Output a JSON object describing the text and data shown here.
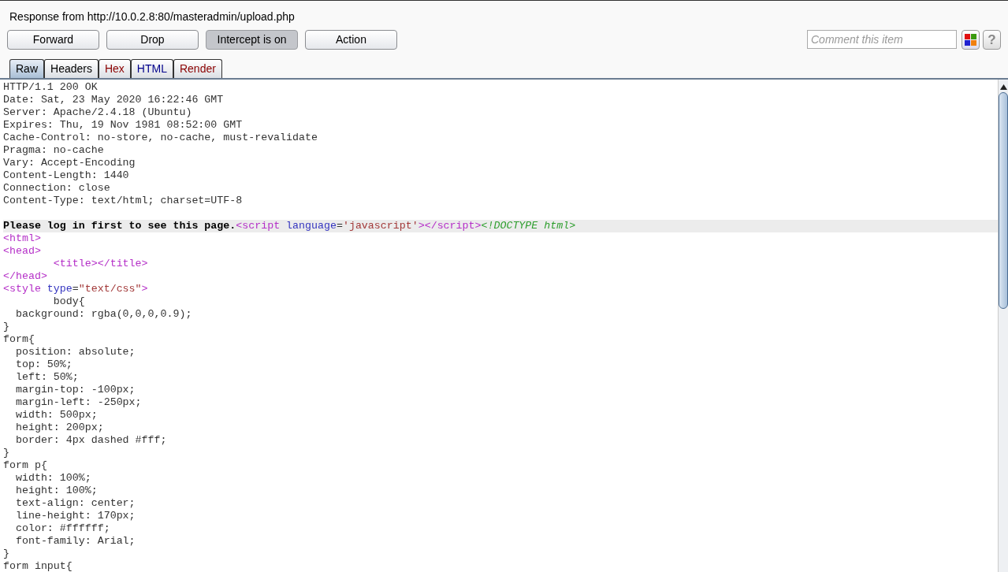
{
  "window": {
    "title": "Response from http://10.0.2.8:80/masteradmin/upload.php"
  },
  "buttons": [
    {
      "label": "Forward",
      "selected": false
    },
    {
      "label": "Drop",
      "selected": false
    },
    {
      "label": "Intercept is on",
      "selected": true
    },
    {
      "label": "Action",
      "selected": false
    }
  ],
  "comment": {
    "placeholder": "Comment this item"
  },
  "help_button": {
    "label": "?"
  },
  "tabs": [
    {
      "label": "Raw",
      "selected": true,
      "color": "#000000"
    },
    {
      "label": "Headers",
      "selected": false,
      "color": "#000000"
    },
    {
      "label": "Hex",
      "selected": false,
      "color": "#8b0000"
    },
    {
      "label": "HTML",
      "selected": false,
      "color": "#00008b"
    },
    {
      "label": "Render",
      "selected": false,
      "color": "#8b0000"
    }
  ],
  "lines": [
    {
      "kind": "code",
      "tokens": [
        {
          "kind": "plain",
          "text": "HTTP/1.1 200 OK"
        }
      ]
    },
    {
      "kind": "code",
      "tokens": [
        {
          "kind": "plain",
          "text": "Date: Sat, 23 May 2020 16:22:46 GMT"
        }
      ]
    },
    {
      "kind": "code",
      "tokens": [
        {
          "kind": "plain",
          "text": "Server: Apache/2.4.18 (Ubuntu)"
        }
      ]
    },
    {
      "kind": "code",
      "tokens": [
        {
          "kind": "plain",
          "text": "Expires: Thu, 19 Nov 1981 08:52:00 GMT"
        }
      ]
    },
    {
      "kind": "code",
      "tokens": [
        {
          "kind": "plain",
          "text": "Cache-Control: no-store, no-cache, must-revalidate"
        }
      ]
    },
    {
      "kind": "code",
      "tokens": [
        {
          "kind": "plain",
          "text": "Pragma: no-cache"
        }
      ]
    },
    {
      "kind": "code",
      "tokens": [
        {
          "kind": "plain",
          "text": "Vary: Accept-Encoding"
        }
      ]
    },
    {
      "kind": "code",
      "tokens": [
        {
          "kind": "plain",
          "text": "Content-Length: 1440"
        }
      ]
    },
    {
      "kind": "code",
      "tokens": [
        {
          "kind": "plain",
          "text": "Connection: close"
        }
      ]
    },
    {
      "kind": "code",
      "tokens": [
        {
          "kind": "plain",
          "text": "Content-Type: text/html; charset=UTF-8"
        }
      ]
    },
    {
      "kind": "blank"
    },
    {
      "kind": "highlighted",
      "tokens": [
        {
          "kind": "bold",
          "text": "Please log in first to see this page."
        },
        {
          "kind": "tag",
          "text": "<script "
        },
        {
          "kind": "attr",
          "text": "language"
        },
        {
          "kind": "plain",
          "text": "="
        },
        {
          "kind": "string",
          "text": "'javascript'"
        },
        {
          "kind": "tag",
          "text": "></script>"
        },
        {
          "kind": "doctype",
          "text": "<!DOCTYPE html>"
        }
      ]
    },
    {
      "kind": "code",
      "tokens": [
        {
          "kind": "tag",
          "text": "<html>"
        }
      ]
    },
    {
      "kind": "code",
      "tokens": [
        {
          "kind": "tag",
          "text": "<head>"
        }
      ]
    },
    {
      "kind": "code",
      "tokens": [
        {
          "kind": "tag",
          "text": "        <title></title>"
        }
      ]
    },
    {
      "kind": "code",
      "tokens": [
        {
          "kind": "tag",
          "text": "</head>"
        }
      ]
    },
    {
      "kind": "code",
      "tokens": [
        {
          "kind": "tag",
          "text": "<style "
        },
        {
          "kind": "attr",
          "text": "type"
        },
        {
          "kind": "plain",
          "text": "="
        },
        {
          "kind": "string",
          "text": "\"text/css\""
        },
        {
          "kind": "tag",
          "text": ">"
        }
      ]
    },
    {
      "kind": "code",
      "tokens": [
        {
          "kind": "plain",
          "text": "        body{"
        }
      ]
    },
    {
      "kind": "code",
      "tokens": [
        {
          "kind": "plain",
          "text": "  background: rgba(0,0,0,0.9);"
        }
      ]
    },
    {
      "kind": "code",
      "tokens": [
        {
          "kind": "plain",
          "text": "}"
        }
      ]
    },
    {
      "kind": "code",
      "tokens": [
        {
          "kind": "plain",
          "text": "form{"
        }
      ]
    },
    {
      "kind": "code",
      "tokens": [
        {
          "kind": "plain",
          "text": "  position: absolute;"
        }
      ]
    },
    {
      "kind": "code",
      "tokens": [
        {
          "kind": "plain",
          "text": "  top: 50%;"
        }
      ]
    },
    {
      "kind": "code",
      "tokens": [
        {
          "kind": "plain",
          "text": "  left: 50%;"
        }
      ]
    },
    {
      "kind": "code",
      "tokens": [
        {
          "kind": "plain",
          "text": "  margin-top: -100px;"
        }
      ]
    },
    {
      "kind": "code",
      "tokens": [
        {
          "kind": "plain",
          "text": "  margin-left: -250px;"
        }
      ]
    },
    {
      "kind": "code",
      "tokens": [
        {
          "kind": "plain",
          "text": "  width: 500px;"
        }
      ]
    },
    {
      "kind": "code",
      "tokens": [
        {
          "kind": "plain",
          "text": "  height: 200px;"
        }
      ]
    },
    {
      "kind": "code",
      "tokens": [
        {
          "kind": "plain",
          "text": "  border: 4px dashed #fff;"
        }
      ]
    },
    {
      "kind": "code",
      "tokens": [
        {
          "kind": "plain",
          "text": "}"
        }
      ]
    },
    {
      "kind": "code",
      "tokens": [
        {
          "kind": "plain",
          "text": "form p{"
        }
      ]
    },
    {
      "kind": "code",
      "tokens": [
        {
          "kind": "plain",
          "text": "  width: 100%;"
        }
      ]
    },
    {
      "kind": "code",
      "tokens": [
        {
          "kind": "plain",
          "text": "  height: 100%;"
        }
      ]
    },
    {
      "kind": "code",
      "tokens": [
        {
          "kind": "plain",
          "text": "  text-align: center;"
        }
      ]
    },
    {
      "kind": "code",
      "tokens": [
        {
          "kind": "plain",
          "text": "  line-height: 170px;"
        }
      ]
    },
    {
      "kind": "code",
      "tokens": [
        {
          "kind": "plain",
          "text": "  color: #ffffff;"
        }
      ]
    },
    {
      "kind": "code",
      "tokens": [
        {
          "kind": "plain",
          "text": "  font-family: Arial;"
        }
      ]
    },
    {
      "kind": "code",
      "tokens": [
        {
          "kind": "plain",
          "text": "}"
        }
      ]
    },
    {
      "kind": "code",
      "tokens": [
        {
          "kind": "plain",
          "text": "form input{"
        }
      ]
    }
  ]
}
